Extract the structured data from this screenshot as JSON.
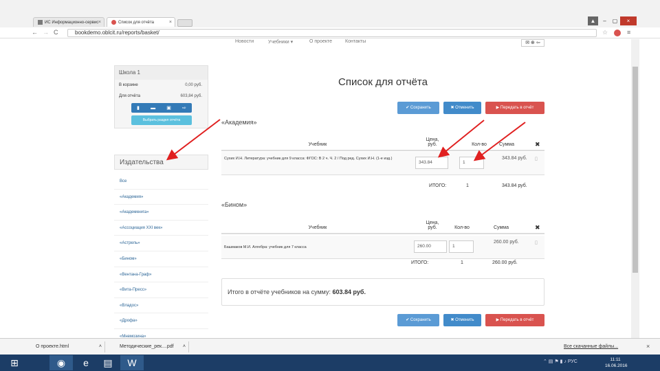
{
  "browser": {
    "tabs": [
      {
        "label": "ИС Информационно-сервис",
        "active": false
      },
      {
        "label": "Список для отчёта",
        "active": true
      }
    ],
    "url": "bookdemo.oblcit.ru/reports/basket/"
  },
  "topnav": {
    "items": [
      "Новости",
      "Учебники ▾",
      "О проекте",
      "Контакты"
    ],
    "right_icons": "✉ ⊕ ⇦"
  },
  "sidebar": {
    "school": "Школа 1",
    "basket_label": "В корзине",
    "basket_value": "0,00 руб.",
    "report_label": "Для отчёта",
    "report_value": "603,84 руб.",
    "icons": [
      "▮",
      "▬",
      "▣",
      "⇨"
    ],
    "button_label": "Выбрать раздел отчёта",
    "publishers_heading": "Издательства",
    "publishers": [
      "Все",
      "«Академия»",
      "«Академкнига»",
      "«Ассоциация XXI век»",
      "«Астрель»",
      "«Бином»",
      "«Вентана-Граф»",
      "«Вита-Пресс»",
      "«Владос»",
      "«Дрофа»",
      "«Мнемозина»"
    ]
  },
  "main": {
    "title": "Список для отчёта",
    "save_label": "✔ Сохранить",
    "cancel_label": "✖ Отменить",
    "send_label": "▶ Передать в отчёт",
    "col_book": "Учебник",
    "col_price": "Цена, руб.",
    "col_qty": "Кол-во",
    "col_sum": "Сумма",
    "col_delete": "✖",
    "total_label": "ИТОГО:",
    "groups": [
      {
        "publisher": "«Академия»",
        "book": "Сухих И.Н. Литература: учебник для 9 класса: ФГОС: В 2 ч. Ч. 2 / Под ред. Сухих И.Н. (1-е изд.)",
        "price": "343.84",
        "qty": "1",
        "sum": "343.84 руб.",
        "total_qty": "1",
        "total_sum": "343.84 руб."
      },
      {
        "publisher": "«Бином»",
        "book": "Башмаков М.И. Алгебра: учебник для 7 класса",
        "price": "260.00",
        "qty": "1",
        "sum": "260.00 руб.",
        "total_qty": "1",
        "total_sum": "260.00 руб."
      }
    ],
    "summary_text": "Итого в отчёте учебников на сумму:",
    "summary_value": "603.84 руб."
  },
  "downloads": {
    "items": [
      "О проекте.html",
      "Методические_рек....pdf"
    ],
    "show_all": "Все скачанные файлы..."
  },
  "taskbar": {
    "clock_time": "11:11",
    "clock_date": "16.06.2016",
    "lang": "РУС"
  },
  "colors": {
    "save": "#5b9bd5",
    "cancel": "#428bca",
    "send": "#d9534f",
    "arrow": "#e02020",
    "taskbar": "#1c3d66"
  }
}
